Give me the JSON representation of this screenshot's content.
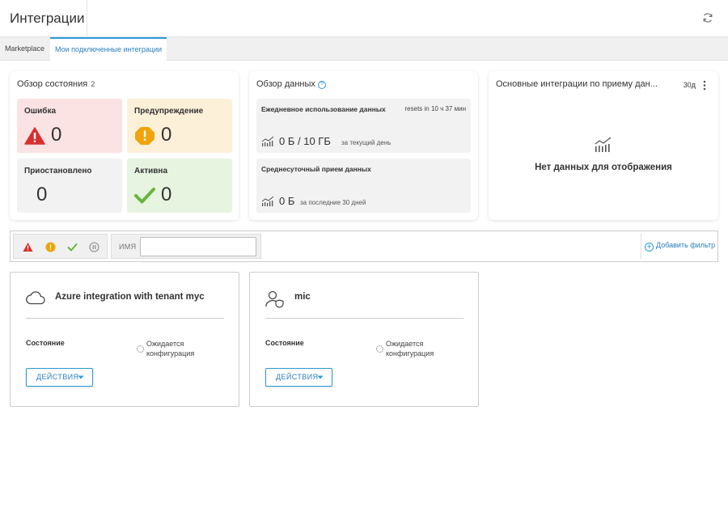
{
  "header": {
    "title": "Интеграции"
  },
  "tabs": [
    {
      "label": "Marketplace"
    },
    {
      "label": "Мои подключенные интеграции"
    }
  ],
  "status_overview": {
    "title": "Обзор состояния",
    "count": "2",
    "tiles": [
      {
        "label": "Ошибка",
        "value": "0",
        "color": "#fbe3e3"
      },
      {
        "label": "Предупреждение",
        "value": "0",
        "color": "#fdf0d9"
      },
      {
        "label": "Приостановлено",
        "value": "0",
        "color": "#f2f2f2"
      },
      {
        "label": "Активна",
        "value": "0",
        "color": "#e7f4e0"
      }
    ]
  },
  "data_overview": {
    "title": "Обзор данных",
    "daily": {
      "label": "Ежедневное использование данных",
      "reset": "resets in 10 ч 37 мин",
      "value": "0 Б / 10 ГБ",
      "sub": "за текущий день"
    },
    "average": {
      "label": "Среднесуточный прием данных",
      "value": "0 Б",
      "sub": "за последние 30 дней"
    }
  },
  "top_integrations": {
    "title": "Основные интеграции по приему дан...",
    "period": "30д",
    "empty": "Нет данных для отображения"
  },
  "filter": {
    "name_label": "ИМЯ",
    "name_value": "",
    "add_filter": "Добавить фильтр"
  },
  "integrations": [
    {
      "name": "Azure integration with tenant myc",
      "icon": "cloud-icon",
      "state_label": "Состояние",
      "state_value": "Ожидается конфигурация",
      "actions_label": "ДЕЙСТВИЯ"
    },
    {
      "name": "mic",
      "icon": "user-shield-icon",
      "state_label": "Состояние",
      "state_value": "Ожидается конфигурация",
      "actions_label": "ДЕЙСТВИЯ"
    }
  ]
}
